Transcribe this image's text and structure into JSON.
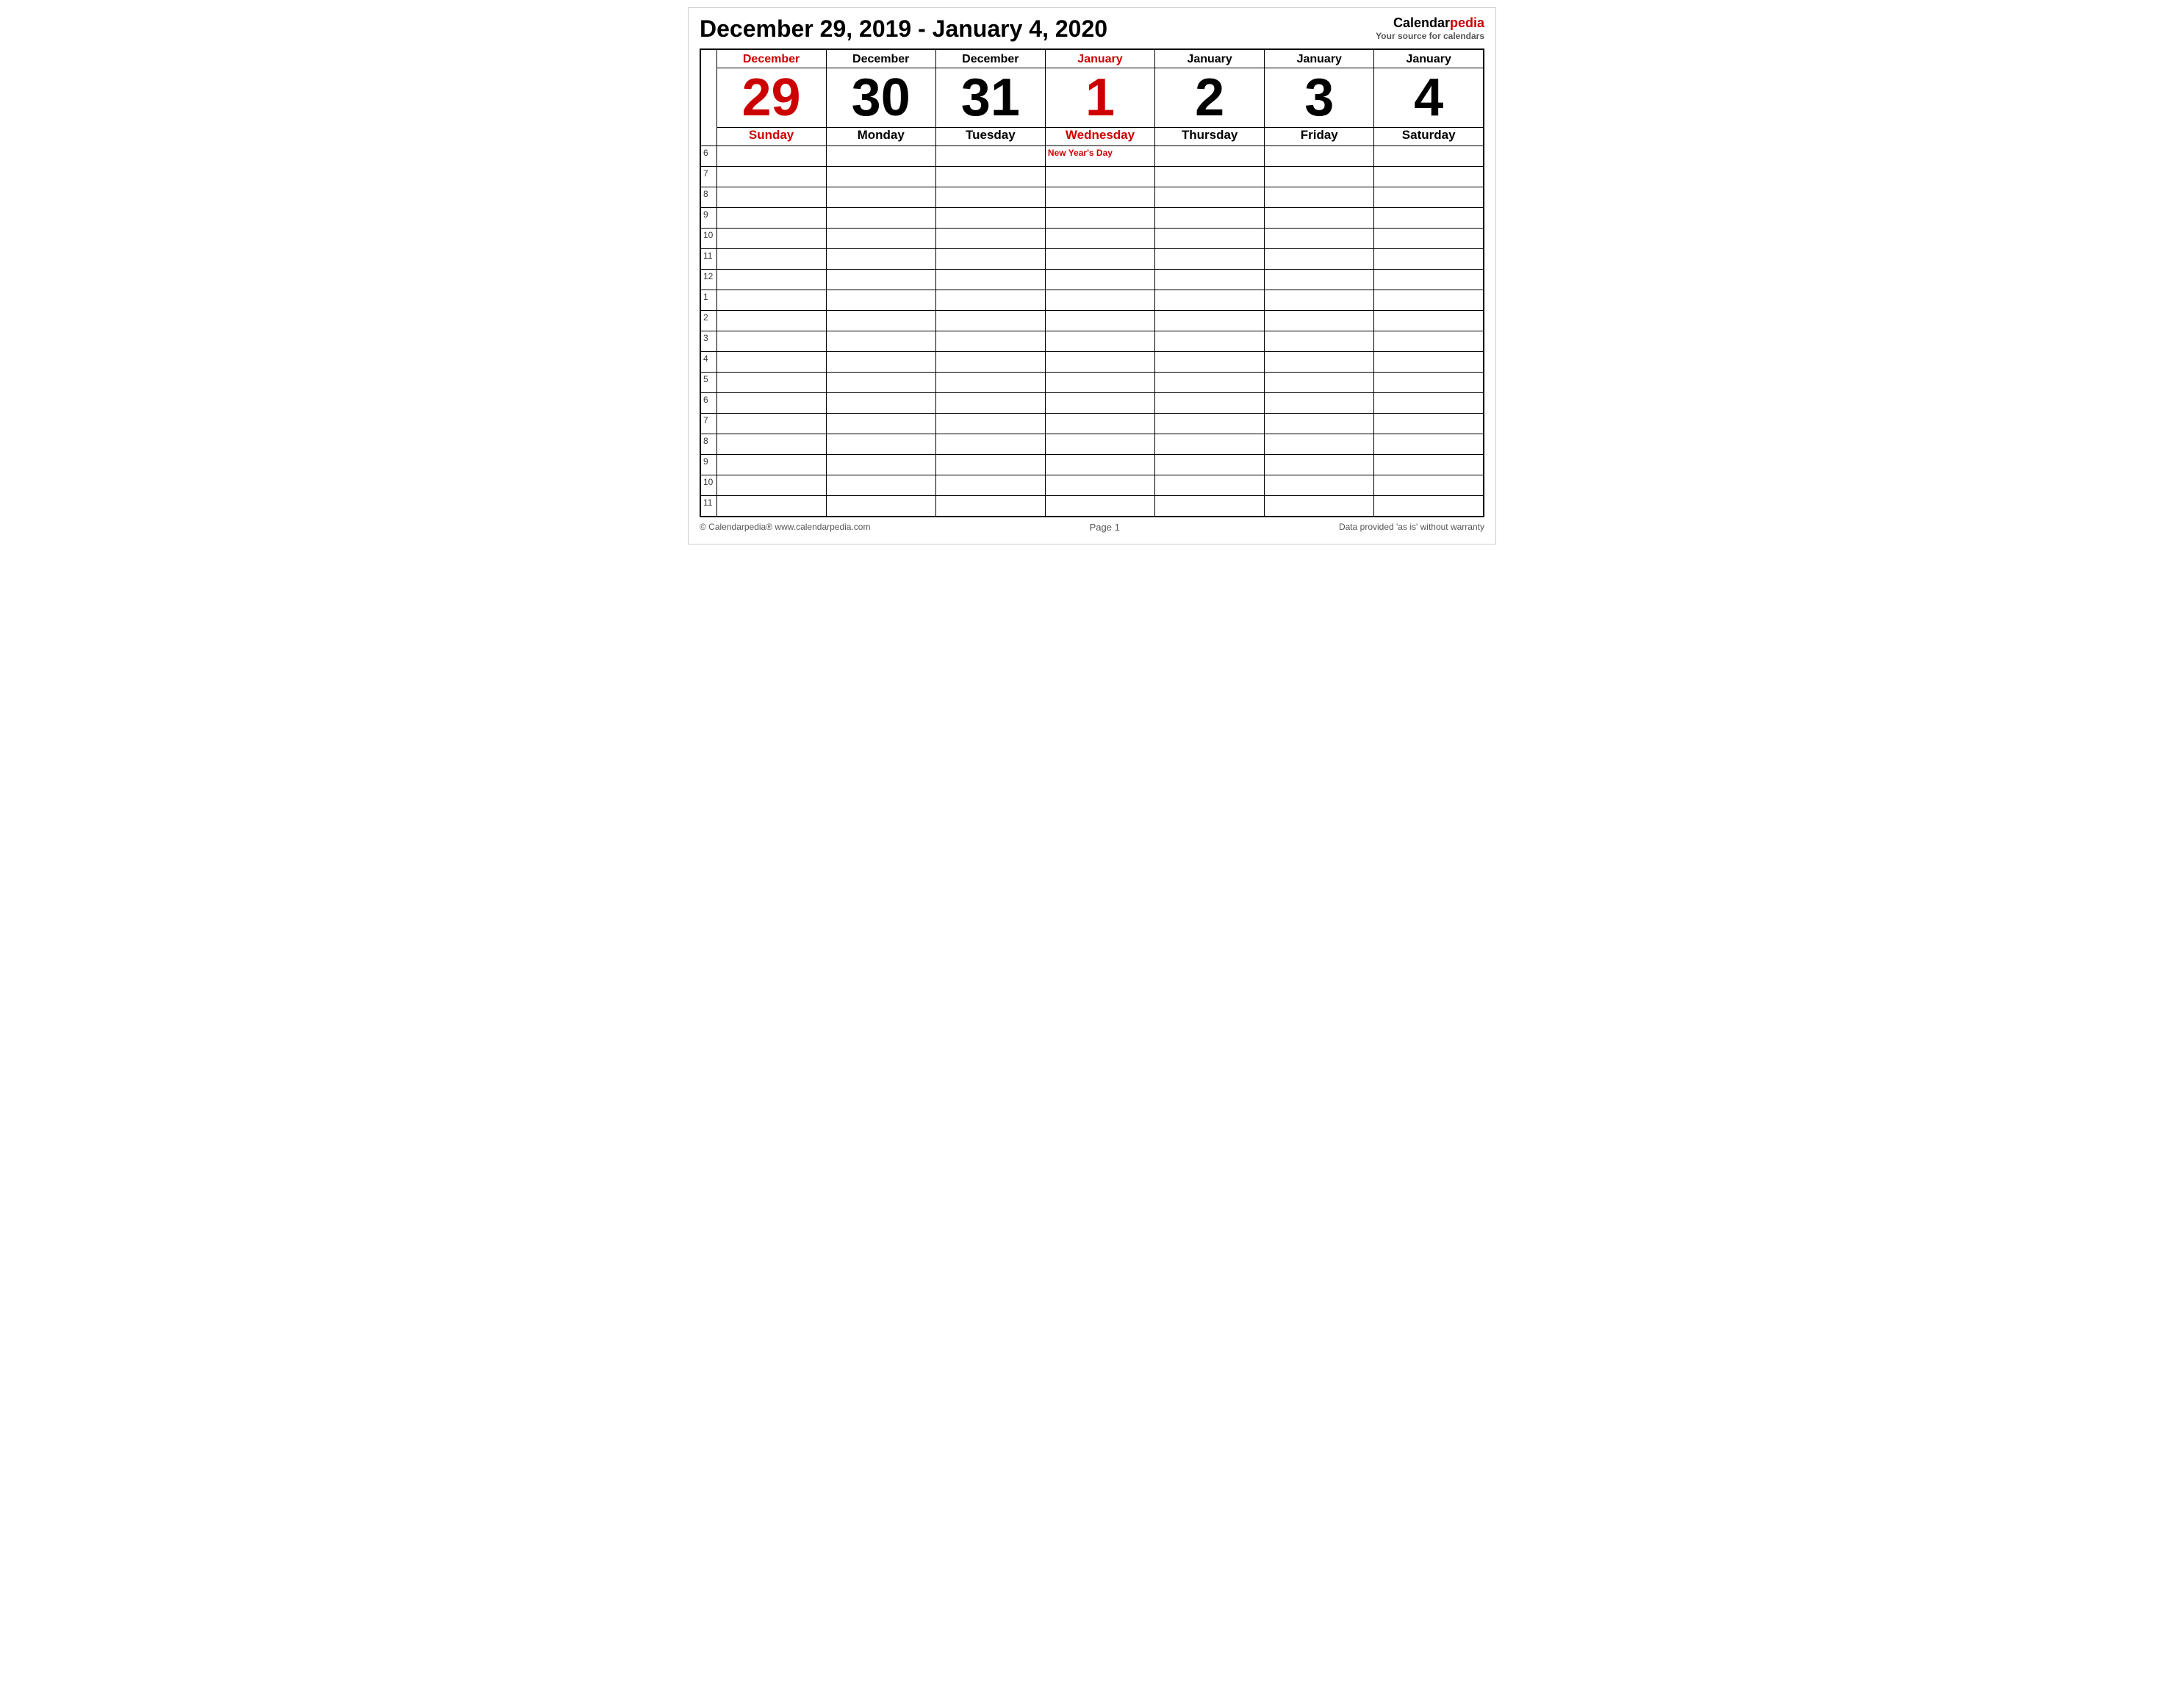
{
  "page": {
    "title": "December 29, 2019 - January 4, 2020",
    "page_number": "Page 1"
  },
  "brand": {
    "name_part1": "Calendar",
    "name_part2": "pedia",
    "tagline": "Your source for calendars"
  },
  "days": [
    {
      "id": "dec29",
      "month": "December",
      "day_number": "29",
      "day_name": "Sunday",
      "highlight": true,
      "event": ""
    },
    {
      "id": "dec30",
      "month": "December",
      "day_number": "30",
      "day_name": "Monday",
      "highlight": false,
      "event": ""
    },
    {
      "id": "dec31",
      "month": "December",
      "day_number": "31",
      "day_name": "Tuesday",
      "highlight": false,
      "event": ""
    },
    {
      "id": "jan1",
      "month": "January",
      "day_number": "1",
      "day_name": "Wednesday",
      "highlight": true,
      "event": "New Year's Day"
    },
    {
      "id": "jan2",
      "month": "January",
      "day_number": "2",
      "day_name": "Thursday",
      "highlight": false,
      "event": ""
    },
    {
      "id": "jan3",
      "month": "January",
      "day_number": "3",
      "day_name": "Friday",
      "highlight": false,
      "event": ""
    },
    {
      "id": "jan4",
      "month": "January",
      "day_number": "4",
      "day_name": "Saturday",
      "highlight": false,
      "event": ""
    }
  ],
  "time_slots": [
    "6",
    "7",
    "8",
    "9",
    "10",
    "11",
    "12",
    "1",
    "2",
    "3",
    "4",
    "5",
    "6",
    "7",
    "8",
    "9",
    "10",
    "11"
  ],
  "footer": {
    "left": "© Calendarpedia®   www.calendarpedia.com",
    "center": "Page 1",
    "right": "Data provided 'as is' without warranty"
  }
}
